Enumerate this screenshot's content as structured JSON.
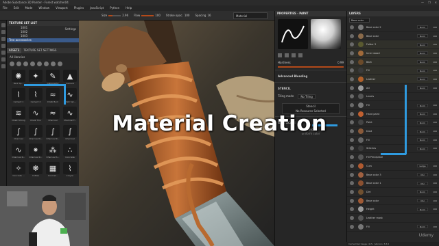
{
  "app": {
    "title": "Adobe Substance 3D Painter - Forest watcher04",
    "window_controls": [
      "—",
      "❐",
      "✕"
    ]
  },
  "menu": [
    "File",
    "Edit",
    "Mode",
    "Window",
    "Viewport",
    "Plugins",
    "JavaScript",
    "Python",
    "Help"
  ],
  "toolbar": {
    "size_label": "Size",
    "size_value": "2.96",
    "flow_label": "Flow",
    "flow_value": "100",
    "stroke_label": "Stroke opac.",
    "stroke_value": "100",
    "spacing_label": "Spacing",
    "spacing_value": "16",
    "viewport_mode": "Material"
  },
  "texture_set_list": {
    "title": "TEXTURE SET LIST",
    "settings_label": "Settings",
    "items": [
      "1001",
      "1002",
      "1003"
    ],
    "selected": "Tree accessories"
  },
  "assets": {
    "tabs": [
      "ASSETS",
      "TEXTURE SET SETTINGS"
    ],
    "all_label": "All libraries",
    "grid": [
      {
        "name": "Bark Sp...",
        "glyph": "✺"
      },
      {
        "name": "",
        "glyph": "✦"
      },
      {
        "name": "Calligraphy",
        "glyph": "✎"
      },
      {
        "name": "Cement",
        "glyph": "▲"
      },
      {
        "name": "Cement 1",
        "glyph": "⌇"
      },
      {
        "name": "Cement 2",
        "glyph": "⌇"
      },
      {
        "name": "Chalk Bum",
        "glyph": "≈"
      },
      {
        "name": "Chalk Spr...",
        "glyph": "∿"
      },
      {
        "name": "Chalk Strong",
        "glyph": "≋"
      },
      {
        "name": "Chalk Thin",
        "glyph": "∿"
      },
      {
        "name": "Charcoal",
        "glyph": "≈"
      },
      {
        "name": "Charcoal F...",
        "glyph": "∿"
      },
      {
        "name": "Charcoal",
        "glyph": "∫"
      },
      {
        "name": "Charcoal N...",
        "glyph": "∫"
      },
      {
        "name": "Charcoal R...",
        "glyph": "∫"
      },
      {
        "name": "Charcoal",
        "glyph": "∫"
      },
      {
        "name": "Charcoal R...",
        "glyph": "∿"
      },
      {
        "name": "Charcoal R...",
        "glyph": "⁕"
      },
      {
        "name": "Charcoal S...",
        "glyph": "⁂"
      },
      {
        "name": "Concrete",
        "glyph": "∴"
      },
      {
        "name": "Concrete ...",
        "glyph": "✧"
      },
      {
        "name": "Cottee",
        "glyph": "❋"
      },
      {
        "name": "Concret...",
        "glyph": "▦"
      },
      {
        "name": "Crayon",
        "glyph": "⌇"
      }
    ]
  },
  "viewport": {
    "overlay_title": "Material Creation"
  },
  "properties": {
    "title": "PROPERTIES - PAINT",
    "hardness_label": "Hardness",
    "hardness_value": "0.99",
    "advanced_blending": "Advanced Blending",
    "stencil_title": "STENCIL",
    "tiling_label": "Tiling mode",
    "tiling_value": "No Tiling",
    "stencil_btn": "Stencil",
    "no_resource": "No Resource Selected",
    "grayscale_title": "GRAYSCALE",
    "grayscale_value": "grayscale",
    "uniform_color": "uniform color"
  },
  "layers": {
    "title": "LAYERS",
    "channel": "Base color",
    "rows": [
      {
        "name": "Base color 2",
        "blend": "Norm",
        "val": "100",
        "swatch": "#7a7a7a",
        "folder": false
      },
      {
        "name": "Base color",
        "blend": "Norm",
        "val": "100",
        "swatch": "#8a6a4a",
        "folder": false
      },
      {
        "name": "Folder 3",
        "blend": "Norm",
        "val": "100",
        "swatch": "#5a5a30",
        "folder": true
      },
      {
        "name": "Inner wood",
        "blend": "Norm",
        "val": "100",
        "swatch": "#a06a3a",
        "folder": true
      },
      {
        "name": "Bark",
        "blend": "Norm",
        "val": "100",
        "swatch": "#6a4a2a",
        "folder": true
      },
      {
        "name": "Fill",
        "blend": "Norm",
        "val": "100",
        "swatch": "#3a3a3a",
        "folder": true
      },
      {
        "name": "Leather",
        "blend": "Norm",
        "val": "100",
        "swatch": "#b0602a",
        "folder": true
      },
      {
        "name": "AO",
        "blend": "Norm",
        "val": "100",
        "swatch": "#9a9a9a",
        "folder": false
      },
      {
        "name": "Levels",
        "blend": "",
        "val": "",
        "swatch": "#555",
        "folder": false
      },
      {
        "name": "Fill",
        "blend": "Norm",
        "val": "100",
        "swatch": "#777",
        "folder": false
      },
      {
        "name": "Hand paint",
        "blend": "Norm",
        "val": "100",
        "swatch": "#c06030",
        "folder": false
      },
      {
        "name": "Paint",
        "blend": "Norm",
        "val": "100",
        "swatch": "#444",
        "folder": false
      },
      {
        "name": "Dust",
        "blend": "Norm",
        "val": "100",
        "swatch": "#8a5a3a",
        "folder": false
      },
      {
        "name": "Fill",
        "blend": "Norm",
        "val": "100",
        "swatch": "#666",
        "folder": false
      },
      {
        "name": "Stitches",
        "blend": "Norm",
        "val": "100",
        "swatch": "#3a3a3a",
        "folder": false
      },
      {
        "name": "Fill Perceptive",
        "blend": "",
        "val": "",
        "swatch": "#555",
        "folder": false
      },
      {
        "name": "Curv",
        "blend": "Ledge",
        "val": "100",
        "swatch": "#b05a30",
        "folder": false
      },
      {
        "name": "Base color 3",
        "blend": "Mul",
        "val": "100",
        "swatch": "#a06040",
        "folder": false
      },
      {
        "name": "Base color 1",
        "blend": "Mul",
        "val": "100",
        "swatch": "#8a5030",
        "folder": false
      },
      {
        "name": "Dirt",
        "blend": "Norm",
        "val": "100",
        "swatch": "#705030",
        "folder": false
      },
      {
        "name": "Base color",
        "blend": "Mul",
        "val": "100",
        "swatch": "#a05a35",
        "folder": false
      },
      {
        "name": "Height",
        "blend": "Norm",
        "val": "100",
        "swatch": "#999",
        "folder": false
      },
      {
        "name": "Leather mask",
        "blend": "",
        "val": "",
        "swatch": "#555",
        "folder": false
      },
      {
        "name": "Fill",
        "blend": "Norm",
        "val": "100",
        "swatch": "#777",
        "folder": false
      }
    ],
    "status": "Cache Disk Usage: 41% | Version: 8.3.0"
  },
  "watermark": "Udemy"
}
